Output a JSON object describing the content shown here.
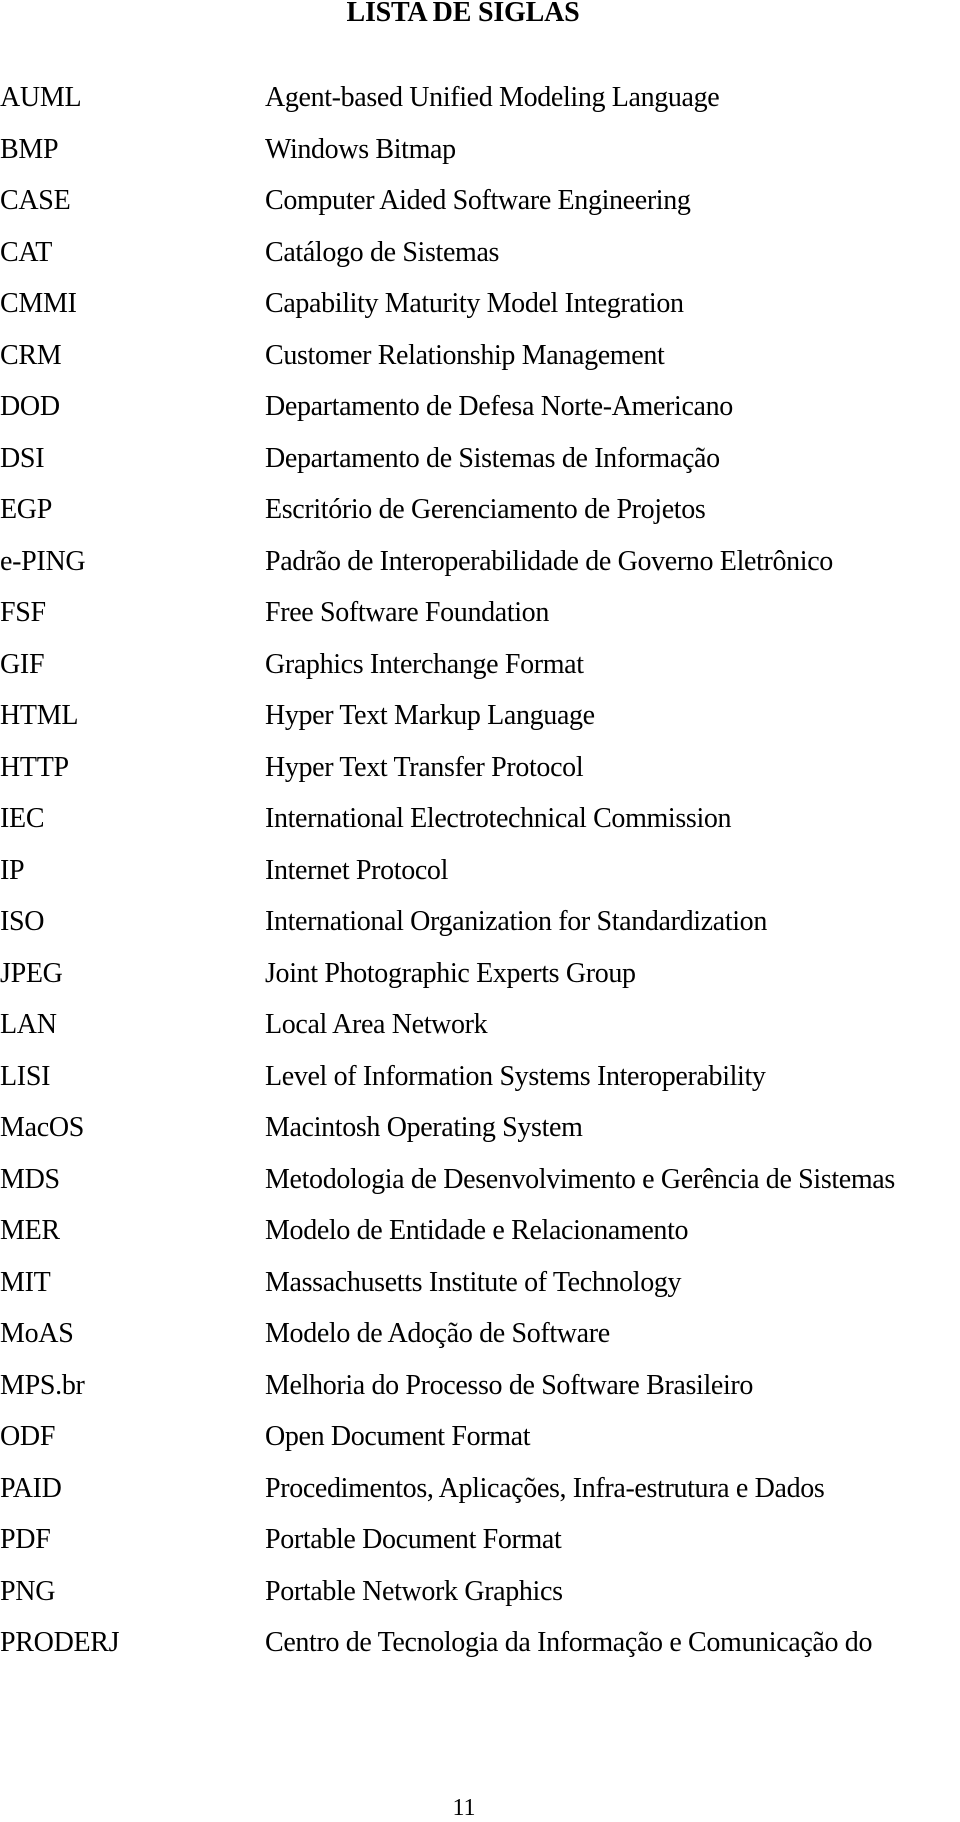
{
  "document": {
    "title": "LISTA DE SIGLAS",
    "page_number": "11",
    "text_color": "#000000",
    "background_color": "#ffffff"
  },
  "acronyms": [
    {
      "code": "AUML",
      "description": "Agent-based Unified Modeling Language"
    },
    {
      "code": "BMP",
      "description": "Windows Bitmap"
    },
    {
      "code": "CASE",
      "description": "Computer Aided Software Engineering"
    },
    {
      "code": "CAT",
      "description": "Catálogo de Sistemas"
    },
    {
      "code": "CMMI",
      "description": "Capability Maturity Model Integration"
    },
    {
      "code": "CRM",
      "description": "Customer Relationship Management"
    },
    {
      "code": "DOD",
      "description": "Departamento de Defesa Norte-Americano"
    },
    {
      "code": "DSI",
      "description": "Departamento de Sistemas de Informação"
    },
    {
      "code": "EGP",
      "description": "Escritório de Gerenciamento de Projetos"
    },
    {
      "code": "e-PING",
      "description": "Padrão de Interoperabilidade de Governo Eletrônico"
    },
    {
      "code": "FSF",
      "description": "Free Software Foundation"
    },
    {
      "code": "GIF",
      "description": "Graphics Interchange Format"
    },
    {
      "code": "HTML",
      "description": "Hyper Text Markup Language"
    },
    {
      "code": "HTTP",
      "description": "Hyper Text Transfer Protocol"
    },
    {
      "code": "IEC",
      "description": "International Electrotechnical Commission"
    },
    {
      "code": "IP",
      "description": "Internet Protocol"
    },
    {
      "code": "ISO",
      "description": "International Organization for Standardization"
    },
    {
      "code": "JPEG",
      "description": "Joint Photographic Experts Group"
    },
    {
      "code": "LAN",
      "description": "Local Area Network"
    },
    {
      "code": "LISI",
      "description": "Level of Information Systems Interoperability"
    },
    {
      "code": "MacOS",
      "description": "Macintosh Operating System"
    },
    {
      "code": "MDS",
      "description": "Metodologia de Desenvolvimento e Gerência de Sistemas"
    },
    {
      "code": "MER",
      "description": "Modelo de Entidade e Relacionamento"
    },
    {
      "code": "MIT",
      "description": "Massachusetts Institute of Technology"
    },
    {
      "code": "MoAS",
      "description": "Modelo de Adoção de Software"
    },
    {
      "code": "MPS.br",
      "description": "Melhoria do Processo de Software Brasileiro"
    },
    {
      "code": "ODF",
      "description": "Open Document Format"
    },
    {
      "code": "PAID",
      "description": "Procedimentos, Aplicações, Infra-estrutura e Dados"
    },
    {
      "code": "PDF",
      "description": "Portable Document Format"
    },
    {
      "code": "PNG",
      "description": "Portable Network Graphics"
    },
    {
      "code": "PRODERJ",
      "description": "Centro de Tecnologia da Informação e Comunicação do"
    }
  ]
}
